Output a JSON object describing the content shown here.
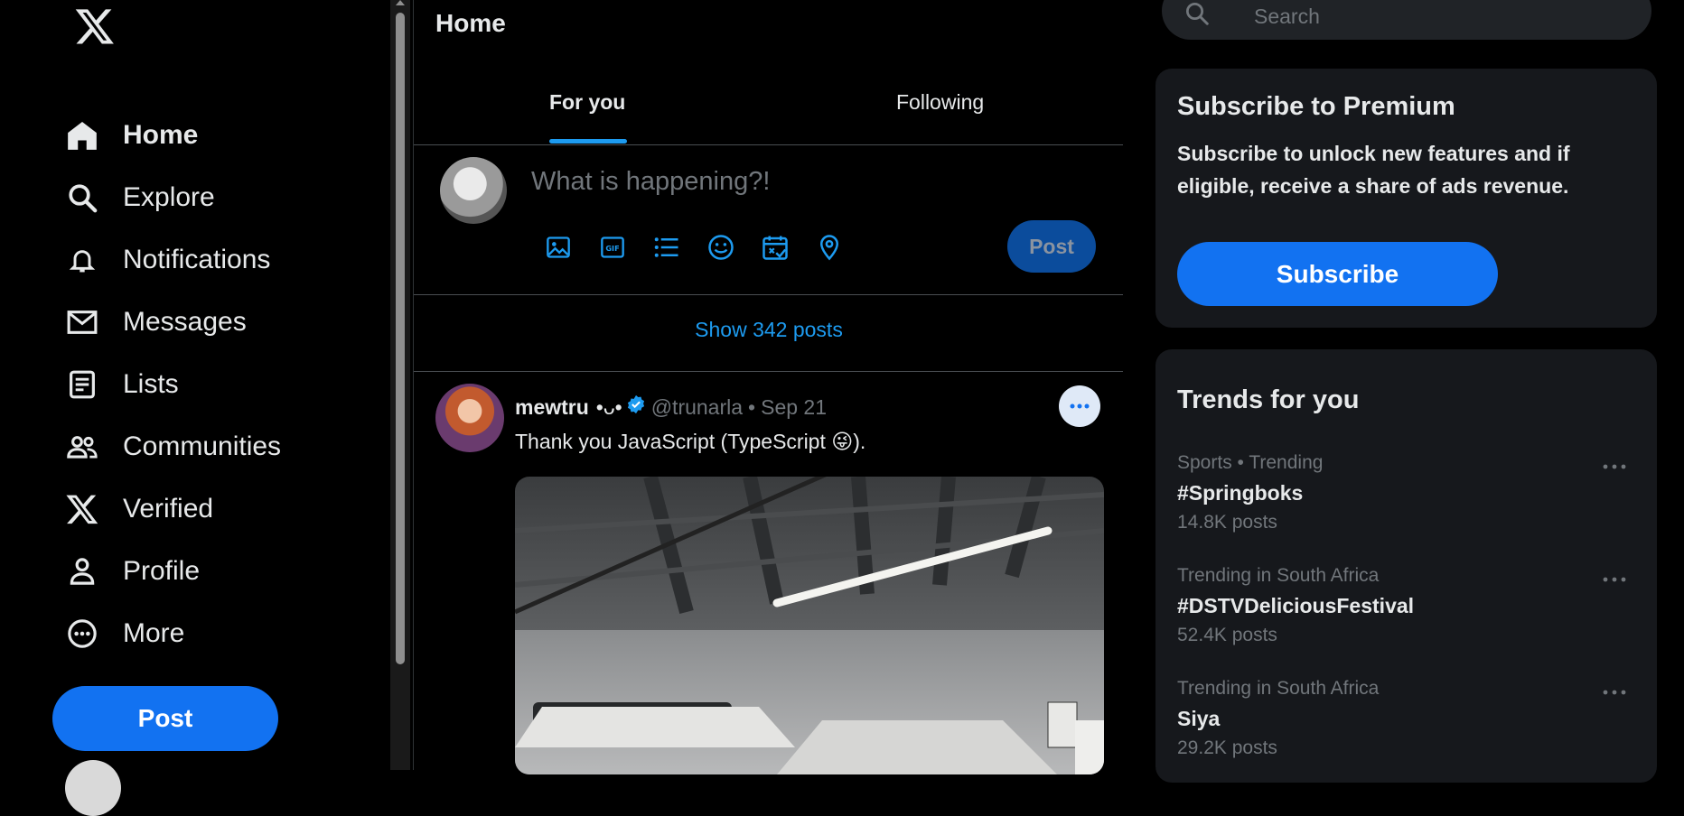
{
  "nav": {
    "items": [
      {
        "label": "Home",
        "icon": "home-icon",
        "active": true
      },
      {
        "label": "Explore",
        "icon": "search-icon"
      },
      {
        "label": "Notifications",
        "icon": "bell-icon"
      },
      {
        "label": "Messages",
        "icon": "mail-icon"
      },
      {
        "label": "Lists",
        "icon": "list-icon"
      },
      {
        "label": "Communities",
        "icon": "people-icon"
      },
      {
        "label": "Verified",
        "icon": "x-logo-icon"
      },
      {
        "label": "Profile",
        "icon": "person-icon"
      },
      {
        "label": "More",
        "icon": "more-circle-icon"
      }
    ],
    "post_label": "Post"
  },
  "main": {
    "title": "Home",
    "tabs": [
      {
        "label": "For you",
        "active": true
      },
      {
        "label": "Following"
      }
    ],
    "compose": {
      "placeholder": "What is happening?!",
      "post_label": "Post",
      "tools": [
        "image-icon",
        "gif-icon",
        "poll-icon",
        "emoji-icon",
        "schedule-icon",
        "location-icon"
      ]
    },
    "show_posts": "Show 342 posts",
    "post": {
      "name": "mewtru",
      "name_decoration": "•ᴗ•",
      "handle": "@trunarla",
      "separator": "•",
      "date": "Sep 21",
      "text": "Thank you JavaScript (TypeScript 😜)."
    }
  },
  "right": {
    "search_placeholder": "Search",
    "premium": {
      "title": "Subscribe to Premium",
      "description": "Subscribe to unlock new features and if eligible, receive a share of ads revenue.",
      "button": "Subscribe"
    },
    "trends": {
      "title": "Trends for you",
      "items": [
        {
          "meta": "Sports • Trending",
          "name": "#Springboks",
          "count": "14.8K posts"
        },
        {
          "meta": "Trending in South Africa",
          "name": "#DSTVDeliciousFestival",
          "count": "52.4K posts"
        },
        {
          "meta": "Trending in South Africa",
          "name": "Siya",
          "count": "29.2K posts"
        }
      ]
    }
  },
  "colors": {
    "accent": "#1d9bf0",
    "button_blue": "#1272f1",
    "background": "#000000",
    "card": "#16181c",
    "muted_text": "#71767b"
  }
}
